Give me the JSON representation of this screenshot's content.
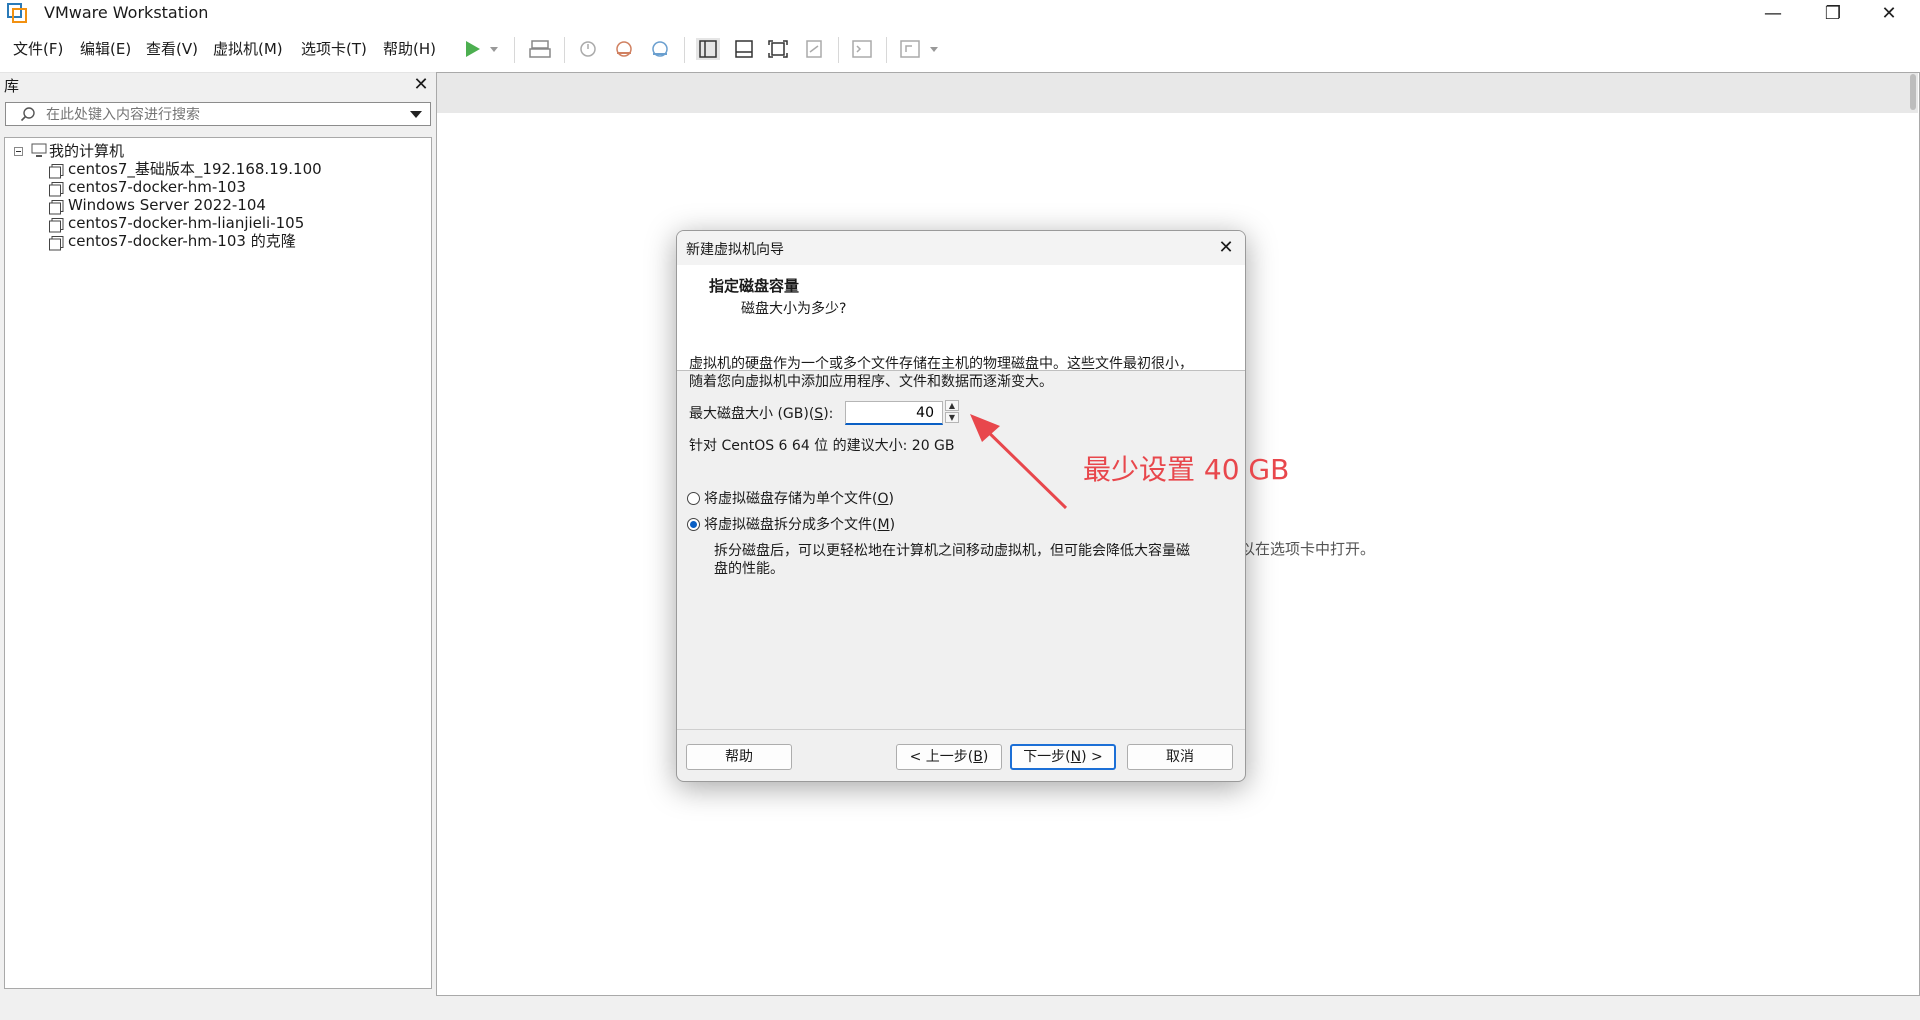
{
  "app": {
    "title": "VMware Workstation"
  },
  "window_controls": {
    "minimize": "—",
    "maximize": "❐",
    "close": "✕"
  },
  "menu": [
    {
      "label": "文件(F)"
    },
    {
      "label": "编辑(E)"
    },
    {
      "label": "查看(V)"
    },
    {
      "label": "虚拟机(M)"
    },
    {
      "label": "选项卡(T)"
    },
    {
      "label": "帮助(H)"
    }
  ],
  "library": {
    "title": "库",
    "close": "✕",
    "search_placeholder": "在此处键入内容进行搜索",
    "root": "我的计算机",
    "vms": [
      "centos7_基础版本_192.168.19.100",
      "centos7-docker-hm-103",
      "Windows Server 2022-104",
      "centos7-docker-hm-lianjieli-105",
      "centos7-docker-hm-103 的克隆"
    ]
  },
  "main": {
    "background_hint": "以在选项卡中打开。"
  },
  "dialog": {
    "title": "新建虚拟机向导",
    "header_title": "指定磁盘容量",
    "header_subtitle": "磁盘大小为多少?",
    "description_line1": "虚拟机的硬盘作为一个或多个文件存储在主机的物理磁盘中。这些文件最初很小，",
    "description_line2": "随着您向虚拟机中添加应用程序、文件和数据而逐渐变大。",
    "size_label_prefix": "最大磁盘大小 (GB)(",
    "size_label_key": "S",
    "size_label_suffix": "):",
    "size_value": "40",
    "recommended": "针对 CentOS 6 64 位 的建议大小: 20 GB",
    "option_single_prefix": "将虚拟磁盘存储为单个文件(",
    "option_single_key": "O",
    "option_single_suffix": ")",
    "option_split_prefix": "将虚拟磁盘拆分成多个文件(",
    "option_split_key": "M",
    "option_split_suffix": ")",
    "split_desc_line1": "拆分磁盘后，可以更轻松地在计算机之间移动虚拟机，但可能会降低大容量磁",
    "split_desc_line2": "盘的性能。",
    "selected_option": "split",
    "buttons": {
      "help": "帮助",
      "back_prefix": "< 上一步(",
      "back_key": "B",
      "back_suffix": ")",
      "next_prefix": "下一步(",
      "next_key": "N",
      "next_suffix": ") >",
      "cancel": "取消"
    }
  },
  "annotation": {
    "text": "最少设置 40 GB",
    "color": "#e8474c"
  },
  "colors": {
    "accent": "#0a5fc4",
    "play": "#4caf50"
  }
}
